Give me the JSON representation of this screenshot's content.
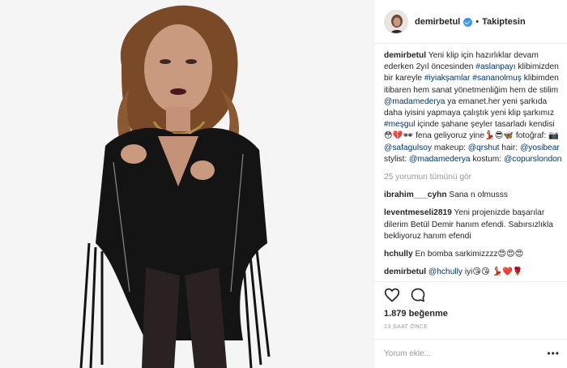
{
  "post": {
    "username": "demirbetul",
    "follow_status": "Takiptesin",
    "dot": "•"
  },
  "caption": {
    "user": "demirbetul",
    "text1": " Yeni klip için hazırlıklar devam ederken 2yıl öncesinden ",
    "tag1": "#aslanpayı",
    "text2": " klibimizden bir kareyle ",
    "tag2": "#iyiakşamlar",
    "tag3": "#sananolmuş",
    "text3": " klibimden itibaren hem sanat yönetmenliğim hem de stilim ",
    "mention1": "@madamederya",
    "text4": " ya emanet.her yeni şarkıda daha iyisini yapmaya çalıştık yeni klip şarkımız ",
    "tag4": "#meşgul",
    "text5": " içinde şahane şeyler tasarladı kendisi😳💔🕶 fena geliyoruz yine💃🏻😎🦋 fotoğraf: 📷 ",
    "mention2": "@safagulsoy",
    "text6": " makeup: ",
    "mention3": "@qrshut",
    "text7": " hair: ",
    "mention4": "@yosibear",
    "text8": " stylist: ",
    "mention5": "@madamederya",
    "text9": " kostum: ",
    "mention6": "@copurslondon"
  },
  "view_all": "25 yorumun tümünü gör",
  "comments": [
    {
      "user": "ibrahim___cyhn",
      "text": " Sana n olmusss"
    },
    {
      "user": "leventmeseli2819",
      "text": " Yeni projenizde başarılar dilerim Betül Demir hanım efendi. Sabırsızlıkla bekliyoruz hanım efendi"
    },
    {
      "user": "hchully",
      "text": " En bomba sarkimizzzz😍😍😍"
    },
    {
      "user": "demirbetul",
      "text": " ",
      "mention": "@hchully",
      "tail": " iyi😘😘 💃🏻❤️🌹"
    }
  ],
  "likes": "1.879 beğenme",
  "time": "13 SAAT ÖNCE",
  "add_comment": {
    "placeholder": "Yorum ekle...",
    "more": "•••"
  }
}
